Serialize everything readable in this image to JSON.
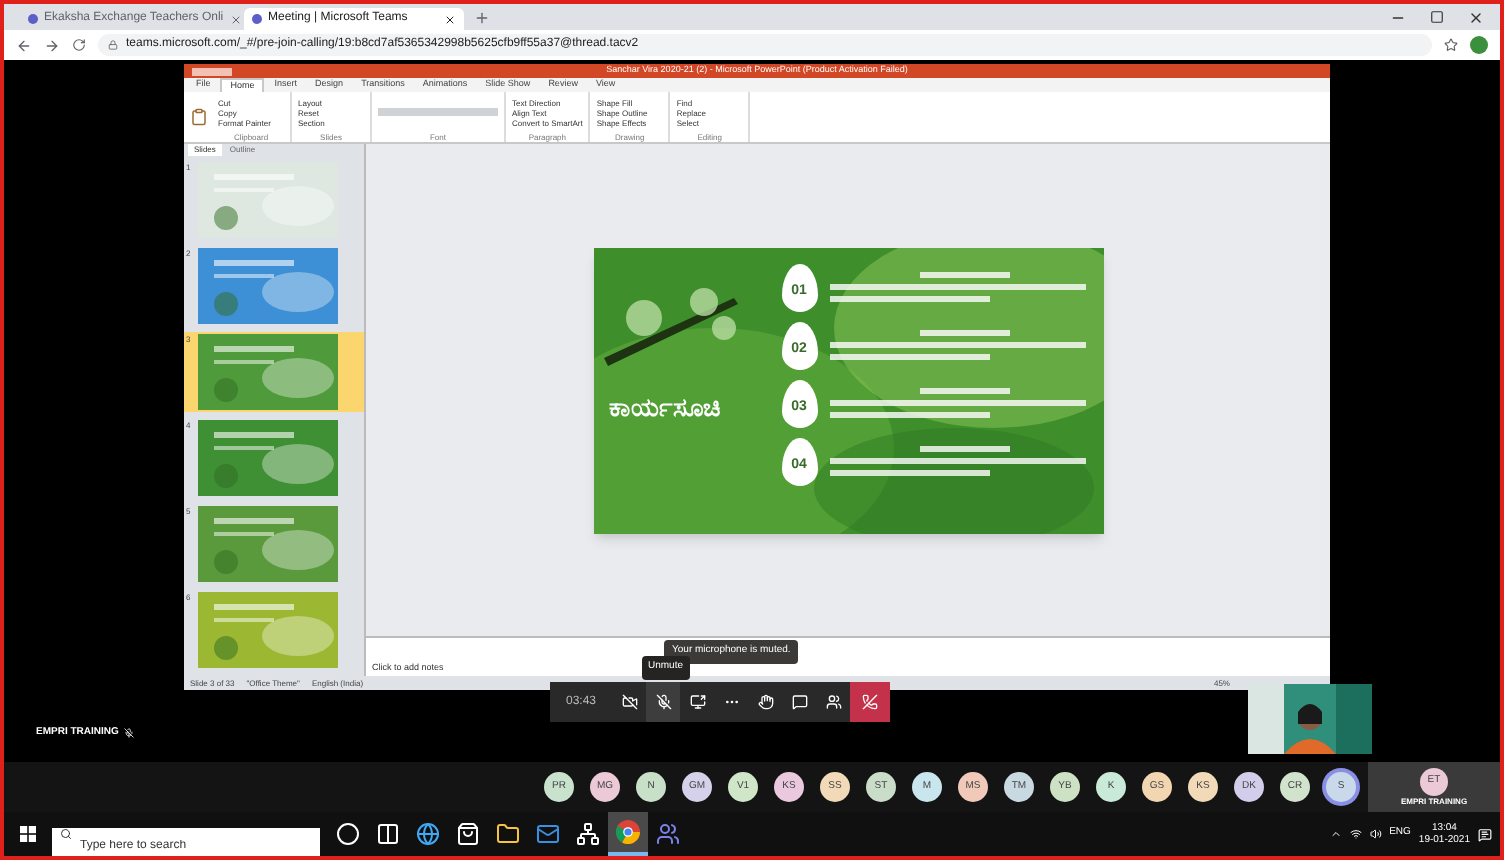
{
  "browser": {
    "tabs": [
      {
        "title": "Ekaksha Exchange Teachers Onli",
        "selected": false
      },
      {
        "title": "Meeting | Microsoft Teams",
        "selected": true
      }
    ],
    "url": "teams.microsoft.com/_#/pre-join-calling/19:b8cd7af5365342998b5625cfb9ff55a37@thread.tacv2"
  },
  "powerpoint": {
    "title": "Sanchar Vira 2020-21 (2) - Microsoft PowerPoint (Product Activation Failed)",
    "ribbon_tabs": [
      {
        "label": "File",
        "selected": false
      },
      {
        "label": "Home",
        "selected": true
      },
      {
        "label": "Insert",
        "selected": false
      },
      {
        "label": "Design",
        "selected": false
      },
      {
        "label": "Transitions",
        "selected": false
      },
      {
        "label": "Animations",
        "selected": false
      },
      {
        "label": "Slide Show",
        "selected": false
      },
      {
        "label": "Review",
        "selected": false
      },
      {
        "label": "View",
        "selected": false
      }
    ],
    "ribbon_groups": [
      {
        "name": "Clipboard",
        "buttons": [
          "Cut",
          "Copy",
          "Format Painter"
        ]
      },
      {
        "name": "Slides",
        "buttons": [
          "Layout",
          "Reset",
          "Section"
        ]
      },
      {
        "name": "Font"
      },
      {
        "name": "Paragraph",
        "buttons": [
          "Text Direction",
          "Align Text",
          "Convert to SmartArt"
        ]
      },
      {
        "name": "Drawing",
        "buttons": [
          "Shape Fill",
          "Shape Outline",
          "Shape Effects"
        ]
      },
      {
        "name": "Editing",
        "buttons": [
          "Find",
          "Replace",
          "Select"
        ]
      }
    ],
    "panel_tabs": [
      {
        "label": "Slides",
        "selected": true
      },
      {
        "label": "Outline",
        "selected": false
      }
    ],
    "thumbnails": [
      {
        "number": "1",
        "color": "#dfe8e0",
        "selected": false
      },
      {
        "number": "2",
        "color": "#3d8fd6",
        "selected": false
      },
      {
        "number": "3",
        "color": "#4f9a3a",
        "selected": true
      },
      {
        "number": "4",
        "color": "#3f8f34",
        "selected": false
      },
      {
        "number": "5",
        "color": "#5a9a3c",
        "selected": false
      },
      {
        "number": "6",
        "color": "#9cb832",
        "selected": false
      }
    ],
    "slide": {
      "title": "ಕಾರ್ಯಸೂಚಿ",
      "items": [
        {
          "number": "01"
        },
        {
          "number": "02"
        },
        {
          "number": "03"
        },
        {
          "number": "04"
        }
      ]
    },
    "notes": {
      "placeholder": "Click to add notes"
    },
    "status": [
      "Slide 3 of 33",
      "\"Office Theme\"",
      "English (India)"
    ],
    "zoom": "45%"
  },
  "teams": {
    "tooltip": "Unmute",
    "toast": "Your microphone is muted.",
    "timer": "03:43",
    "presenter": "EMPRI TRAINING",
    "participants": [
      {
        "initials": "PR",
        "color": "#c9e2cd",
        "selected": false
      },
      {
        "initials": "MG",
        "color": "#ebc9d6",
        "selected": false
      },
      {
        "initials": "N",
        "color": "#c8e0c8",
        "selected": false
      },
      {
        "initials": "GM",
        "color": "#d5d1ea",
        "selected": false
      },
      {
        "initials": "V1",
        "color": "#cfe6c9",
        "selected": false
      },
      {
        "initials": "KS",
        "color": "#eac9de",
        "selected": false
      },
      {
        "initials": "SS",
        "color": "#f2d9b8",
        "selected": false
      },
      {
        "initials": "ST",
        "color": "#c9ddc9",
        "selected": false
      },
      {
        "initials": "M",
        "color": "#c9e5ee",
        "selected": false
      },
      {
        "initials": "MS",
        "color": "#f1c9b8",
        "selected": false
      },
      {
        "initials": "TM",
        "color": "#c9d9e2",
        "selected": false
      },
      {
        "initials": "YB",
        "color": "#cde2c5",
        "selected": false
      },
      {
        "initials": "K",
        "color": "#c9e9d9",
        "selected": false
      },
      {
        "initials": "GS",
        "color": "#f2d6b2",
        "selected": false
      },
      {
        "initials": "KS",
        "color": "#f2d9b8",
        "selected": false
      },
      {
        "initials": "DK",
        "color": "#d1cdea",
        "selected": false
      },
      {
        "initials": "CR",
        "color": "#d1e2cd",
        "selected": false
      },
      {
        "initials": "S",
        "color": "#c9d9ea",
        "selected": true
      }
    ],
    "self": {
      "initials": "ET",
      "name": "EMPRI TRAINING"
    }
  },
  "taskbar": {
    "search": {
      "placeholder": "Type here to search"
    },
    "apps": [
      {
        "kind": "cortana",
        "active": false
      },
      {
        "kind": "taskview",
        "active": false
      },
      {
        "kind": "edge",
        "active": false
      },
      {
        "kind": "store",
        "active": false
      },
      {
        "kind": "explorer",
        "active": false
      },
      {
        "kind": "mail",
        "active": false
      },
      {
        "kind": "network",
        "active": false
      },
      {
        "kind": "chrome",
        "active": true
      },
      {
        "kind": "teams",
        "active": false
      }
    ],
    "language": "ENG",
    "time": "13:04",
    "date": "19-01-2021"
  }
}
